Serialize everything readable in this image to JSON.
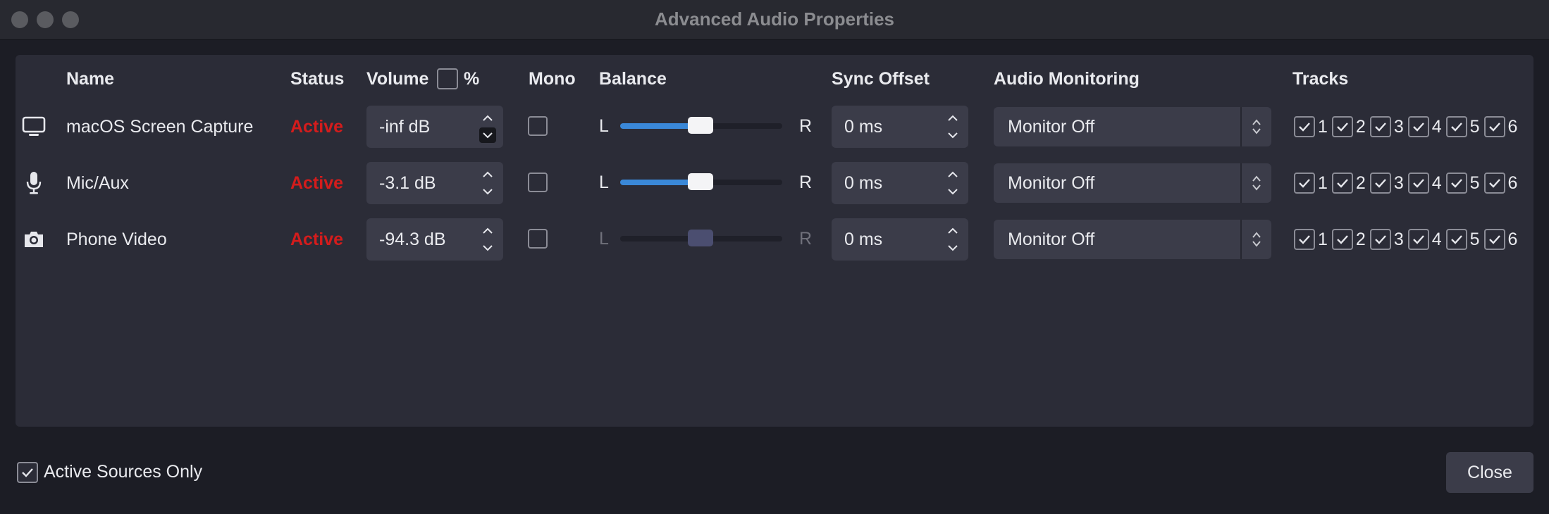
{
  "window": {
    "title": "Advanced Audio Properties",
    "buttons": [
      "close-window",
      "minimize-window",
      "zoom-window"
    ]
  },
  "headers": {
    "name": "Name",
    "status": "Status",
    "volume": "Volume",
    "volume_percent": "%",
    "mono": "Mono",
    "balance": "Balance",
    "sync_offset": "Sync Offset",
    "audio_monitoring": "Audio Monitoring",
    "tracks": "Tracks"
  },
  "sources": [
    {
      "icon": "monitor-icon",
      "name": "macOS Screen Capture",
      "status": "Active",
      "volume": "-inf dB",
      "mono": false,
      "balance_left": "L",
      "balance_right": "R",
      "balance_value": 0.5,
      "balance_enabled": true,
      "sync_offset": "0 ms",
      "monitoring": "Monitor Off",
      "tracks": [
        true,
        true,
        true,
        true,
        true,
        true
      ]
    },
    {
      "icon": "microphone-icon",
      "name": "Mic/Aux",
      "status": "Active",
      "volume": "-3.1 dB",
      "mono": false,
      "balance_left": "L",
      "balance_right": "R",
      "balance_value": 0.5,
      "balance_enabled": true,
      "sync_offset": "0 ms",
      "monitoring": "Monitor Off",
      "tracks": [
        true,
        true,
        true,
        true,
        true,
        true
      ]
    },
    {
      "icon": "camera-icon",
      "name": "Phone Video",
      "status": "Active",
      "volume": "-94.3 dB",
      "mono": false,
      "balance_left": "L",
      "balance_right": "R",
      "balance_value": 0.5,
      "balance_enabled": false,
      "sync_offset": "0 ms",
      "monitoring": "Monitor Off",
      "tracks": [
        true,
        true,
        true,
        true,
        true,
        true
      ]
    }
  ],
  "track_labels": [
    "1",
    "2",
    "3",
    "4",
    "5",
    "6"
  ],
  "footer": {
    "active_only_label": "Active Sources Only",
    "active_only_checked": true,
    "close_label": "Close"
  },
  "colors": {
    "status_active": "#d41c1c",
    "slider_fill": "#3a88d8",
    "panel_bg": "#2b2c37",
    "window_bg": "#1c1d25"
  }
}
